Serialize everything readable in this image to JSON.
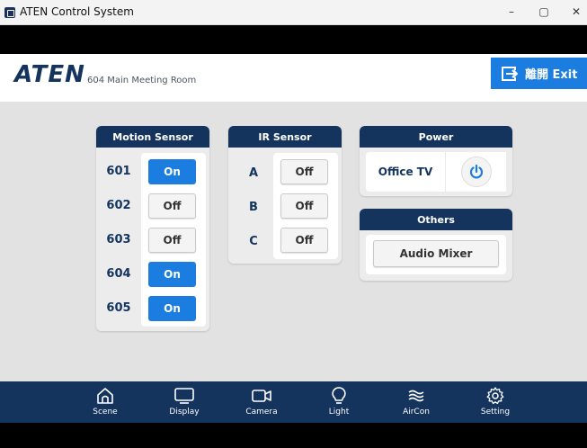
{
  "window": {
    "title": "ATEN Control System",
    "minimize": "–",
    "maximize": "▢",
    "close": "✕"
  },
  "header": {
    "logo": "ATEN",
    "room": "604 Main Meeting Room",
    "exit_label": "離開 Exit"
  },
  "motion_sensor": {
    "title": "Motion Sensor",
    "rows": [
      {
        "label": "601",
        "state": "On"
      },
      {
        "label": "602",
        "state": "Off"
      },
      {
        "label": "603",
        "state": "Off"
      },
      {
        "label": "604",
        "state": "On"
      },
      {
        "label": "605",
        "state": "On"
      }
    ]
  },
  "ir_sensor": {
    "title": "IR Sensor",
    "rows": [
      {
        "label": "A",
        "state": "Off"
      },
      {
        "label": "B",
        "state": "Off"
      },
      {
        "label": "C",
        "state": "Off"
      }
    ]
  },
  "power": {
    "title": "Power",
    "device": "Office TV",
    "icon": "power-icon"
  },
  "others": {
    "title": "Others",
    "button": "Audio Mixer"
  },
  "nav": {
    "items": [
      {
        "label": "Scene",
        "icon": "home-icon"
      },
      {
        "label": "Display",
        "icon": "monitor-icon"
      },
      {
        "label": "Camera",
        "icon": "camera-icon"
      },
      {
        "label": "Light",
        "icon": "bulb-icon"
      },
      {
        "label": "AirCon",
        "icon": "wind-icon"
      },
      {
        "label": "Setting",
        "icon": "gear-icon"
      }
    ]
  },
  "colors": {
    "navy": "#14345e",
    "blue": "#1b7de0",
    "panel": "#ececec"
  }
}
